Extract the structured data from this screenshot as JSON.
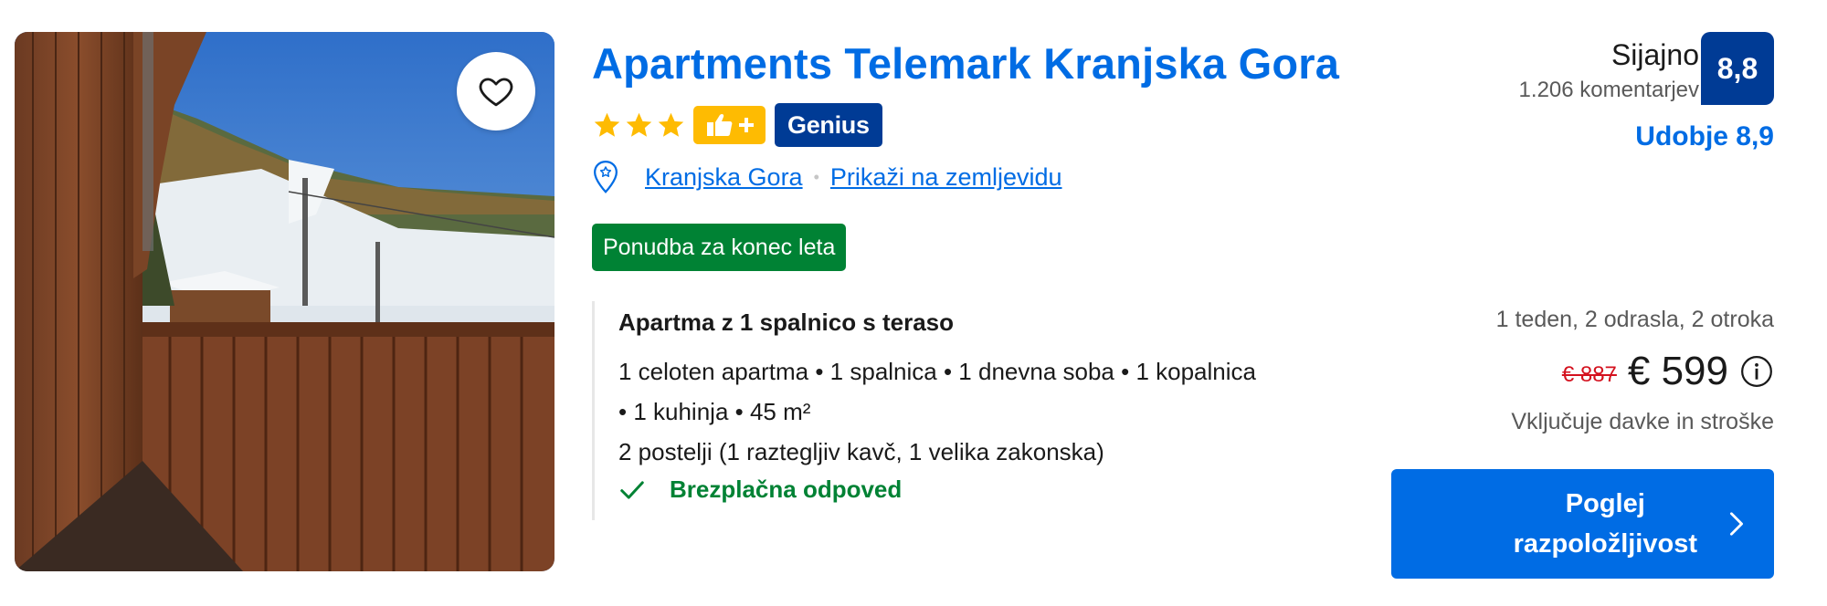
{
  "property": {
    "name": "Apartments Telemark Kranjska Gora",
    "stars": 3,
    "genius_label": "Genius",
    "location": "Kranjska Gora",
    "map_link": "Prikaži na zemljevidu",
    "deal_badge": "Ponudba za konec leta"
  },
  "icons": {
    "favorite": "heart-icon",
    "star": "star-icon",
    "thumbs_up_plus": "thumbs-up-plus-icon",
    "location": "map-pin-icon",
    "check": "check-icon",
    "info": "info-icon",
    "chevron": "chevron-right-icon"
  },
  "room": {
    "title": "Apartma z 1 spalnico s teraso",
    "features_line1": "1 celoten apartma • 1 spalnica • 1 dnevna soba • 1 kopalnica",
    "features_line2": "• 1 kuhinja • 45 m²",
    "beds": "2 postelji (1 raztegljiv kavč, 1 velika zakonska)",
    "cancellation": "Brezplačna odpoved"
  },
  "review": {
    "word": "Sijajno",
    "count": "1.206 komentarjev",
    "score": "8,8",
    "comfort": "Udobje 8,9"
  },
  "pricing": {
    "stay_info": "1 teden, 2 odrasla, 2 otroka",
    "old_price": "€ 887",
    "price": "€ 599",
    "taxes_note": "Vključuje davke in stroške"
  },
  "cta": {
    "line1": "Poglej",
    "line2": "razpoložljivost"
  },
  "colors": {
    "brand_blue": "#006ce4",
    "dark_blue": "#003b95",
    "genius_yellow": "#febb02",
    "success_green": "#008234",
    "old_price_red": "#d4111e"
  }
}
